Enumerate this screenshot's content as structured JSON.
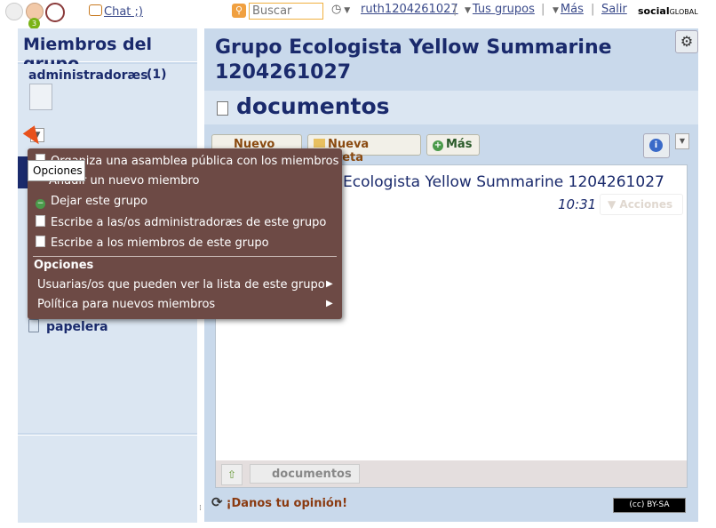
{
  "topbar": {
    "notifications_count": "3",
    "chat_label": "Chat ;)",
    "search_placeholder": "Buscar",
    "user": "ruth1204261027",
    "groups_label": "Tus grupos",
    "more_label": "Más",
    "logout_label": "Salir",
    "logo_main": "social",
    "logo_sub": "GLOBAL"
  },
  "sidebar": {
    "title": "Miembros del grupo",
    "admins_label": "administradoræs",
    "admins_count": "(1)",
    "trash_label": "papelera"
  },
  "main": {
    "group_title": "Grupo Ecologista Yellow Summarine 1204261027",
    "section_title": "documentos",
    "buttons": {
      "new_doc": "Nuevo doc",
      "new_folder": "Nueva carpeta",
      "more": "Más"
    },
    "doc_item_title": "Ecologista Yellow Summarine 1204261027",
    "doc_time": "10:31",
    "actions_label": "Acciones",
    "breadcrumb": "documentos",
    "feedback": "¡Danos tu opinión!",
    "license": "(cc) BY-SA"
  },
  "tooltip": "Opciones",
  "menu": {
    "items": [
      "Organiza una asamblea pública con los miembros",
      "Añadir un nuevo miembro",
      "Dejar este grupo",
      "Escribe a las/os administradoræs de este grupo",
      "Escribe a los miembros de este grupo"
    ],
    "options_header": "Opciones",
    "options": [
      "Usuarias/os que pueden ver la lista de este grupo",
      "Política para nuevos miembros"
    ]
  },
  "colors": {
    "menu_bg": "#6d4a45",
    "panel_bg": "#c9d9eb",
    "title": "#1a2a6c",
    "accent": "#8a4a10"
  }
}
